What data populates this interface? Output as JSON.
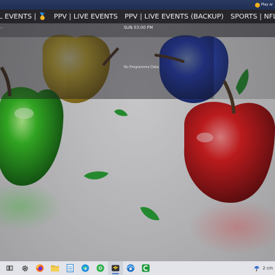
{
  "notification": {
    "text": "Play ar",
    "icon": "gamepad-badge-icon"
  },
  "categories": [
    {
      "label": "L EVENTS | 🥇",
      "active": true
    },
    {
      "label": "PPV | LIVE EVENTS",
      "active": false
    },
    {
      "label": "PPV | LIVE EVENTS (BACKUP)",
      "active": false
    },
    {
      "label": "SPORTS | NFL",
      "active": false
    },
    {
      "label": "SP",
      "active": false
    }
  ],
  "epg": {
    "header_left": "--",
    "time_label": "SUN 03:00 PM",
    "program_text": "No Programme Data"
  },
  "taskbar": {
    "icons": [
      "task-view-icon",
      "settings-gear-icon",
      "firefox-icon",
      "file-explorer-icon",
      "notepad-icon",
      "edge-icon",
      "green-app-icon",
      "active-app-icon",
      "browser-app-icon",
      "camtasia-icon"
    ],
    "active_index": 7
  },
  "tray": {
    "weather_text": "2 cm",
    "weather_icon": "umbrella-icon"
  },
  "colors": {
    "top_bar": "#25365a",
    "category_bar": "#16161c",
    "taskbar": "#e3e4e9"
  }
}
